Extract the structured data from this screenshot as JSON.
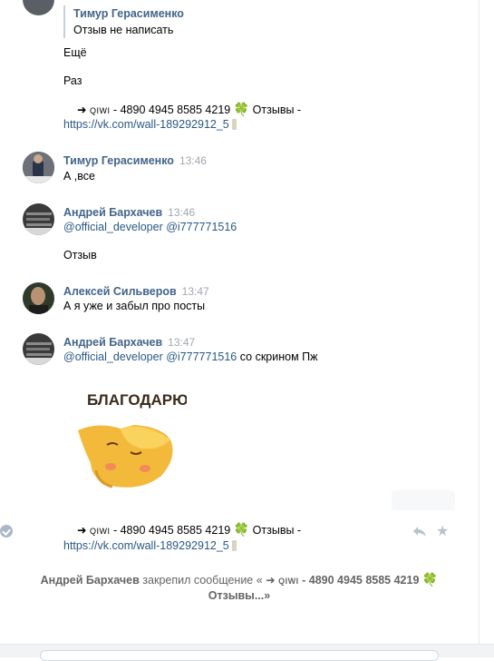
{
  "quote": {
    "author": "Тимур Герасименко",
    "text": "Отзыв не написать"
  },
  "msg0": {
    "lines": [
      "Ещё",
      "Раз"
    ],
    "ad_arrow": "➜",
    "ad_qiwi": "qiwi",
    "ad_number": "- 4890 4945 8585 4219",
    "ad_clover": "🍀",
    "ad_tail": "Отзывы -",
    "ad_link": "https://vk.com/wall-189292912_5"
  },
  "msg1": {
    "author": "Тимур Герасименко",
    "time": "13:46",
    "text": "А ,все"
  },
  "msg2": {
    "author": "Андрей Бархачев",
    "time": "13:46",
    "mentions": "@official_developer @i777771516",
    "text2": "Отзыв"
  },
  "msg3": {
    "author": "Алексей Сильверов",
    "time": "13:47",
    "text": "А я уже и забыл про посты"
  },
  "msg4": {
    "author": "Андрей Бархачев",
    "time": "13:47",
    "mentions": "@official_developer @i777771516",
    "tail": "со скрином Пж",
    "sticker_caption": "БЛАГОДАРЮ"
  },
  "msg5": {
    "ad_arrow": "➜",
    "ad_qiwi": "qiwi",
    "ad_number": "- 4890 4945 8585 4219",
    "ad_clover": "🍀",
    "ad_tail": "Отзывы -",
    "ad_link": "https://vk.com/wall-189292912_5"
  },
  "pin_notice": {
    "author": "Андрей Бархачев",
    "action": "закрепил сообщение «",
    "arrow": "➜",
    "qiwi": "qiwi",
    "number": "- 4890 4945 8585 4219",
    "clover": "🍀",
    "tail": "Отзывы...»"
  },
  "icons": [
    "check-icon",
    "reply-icon",
    "star-icon",
    "clover-icon",
    "candle-icon"
  ],
  "colors": {
    "author": "#42648b",
    "link": "#2a5885",
    "time": "#a1a7b0",
    "quote_bar": "#c5d0db"
  }
}
